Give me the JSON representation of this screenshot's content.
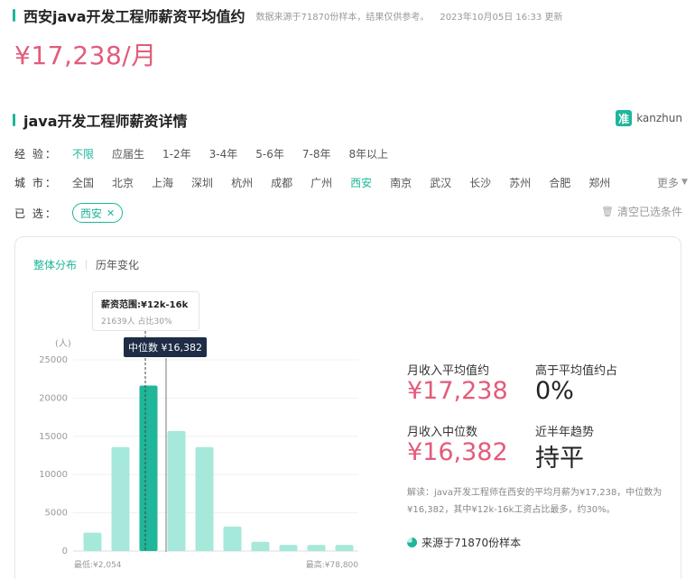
{
  "header": {
    "title": "西安java开发工程师薪资平均值约",
    "source": "数据来源于71870份样本，结果仅供参考。",
    "updated": "2023年10月05日 16:33 更新",
    "salary": "¥17,238/月"
  },
  "section": {
    "title": "java开发工程师薪资详情"
  },
  "brand": {
    "logo_char": "准",
    "name": "kanzhun"
  },
  "filters": {
    "experience": {
      "label": "经 验：",
      "options": [
        "不限",
        "应届生",
        "1-2年",
        "3-4年",
        "5-6年",
        "7-8年",
        "8年以上"
      ],
      "active": 0
    },
    "city": {
      "label": "城 市：",
      "options": [
        "全国",
        "北京",
        "上海",
        "深圳",
        "杭州",
        "成都",
        "广州",
        "西安",
        "南京",
        "武汉",
        "长沙",
        "苏州",
        "合肥",
        "郑州"
      ],
      "active": 7,
      "more": "更多"
    },
    "selected": {
      "label": "已 选：",
      "chip": "西安",
      "clear": "清空已选条件"
    }
  },
  "tabs": [
    "整体分布",
    "历年变化"
  ],
  "tooltip": {
    "title": "薪资范围:¥12k-16k",
    "sub": "21639人  占比30%"
  },
  "median_tag": "中位数 ¥16,382",
  "stats": {
    "avg_label": "月收入平均值约",
    "avg_value": "¥17,238",
    "above_label": "高于平均值约占",
    "above_value": "0%",
    "median_label": "月收入中位数",
    "median_value": "¥16,382",
    "trend_label": "近半年趋势",
    "trend_value": "持平"
  },
  "interpretation": "解读：java开发工程师在西安的平均月薪为¥17,238，中位数为¥16,382，其中¥12k-16k工资占比最多，约30%。",
  "sample": "来源于71870份样本",
  "colors": {
    "accent": "#1fb69a",
    "salary": "#e35b7a",
    "bar": "#a6e8da",
    "bar_highlight": "#1fb69a",
    "tag_bg": "#1e2c45"
  },
  "chart_data": {
    "type": "bar",
    "ylabel": "(人)",
    "yticks": [
      0,
      5000,
      10000,
      15000,
      20000,
      25000
    ],
    "ylim": [
      0,
      25000
    ],
    "values": [
      2400,
      13600,
      21639,
      15700,
      13600,
      3200,
      1200,
      800,
      800,
      800
    ],
    "highlight_index": 2,
    "x_min_label": "最低:¥2,054",
    "x_max_label": "最高:¥78,800"
  }
}
